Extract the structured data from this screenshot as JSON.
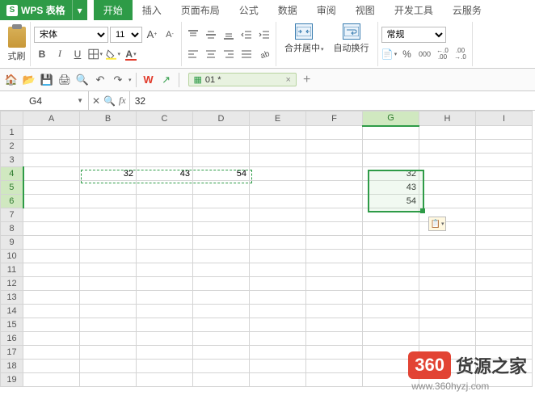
{
  "app": {
    "name": "WPS 表格",
    "logo_letter": "S"
  },
  "tabs": [
    "开始",
    "插入",
    "页面布局",
    "公式",
    "数据",
    "审阅",
    "视图",
    "开发工具",
    "云服务"
  ],
  "active_tab": 0,
  "ribbon": {
    "paste_label": "式刷",
    "font_name": "宋体",
    "font_size": "11",
    "merge_label": "合并居中",
    "wrap_label": "自动换行",
    "number_format": "常规",
    "bold": "B",
    "italic": "I",
    "underline": "U",
    "inc_font": "A",
    "dec_font": "A",
    "currency": "¥",
    "percent": "%",
    "comma": "000",
    "inc_dec_a": "←.0\n.00",
    "inc_dec_b": ".00\n→.0"
  },
  "qat": {
    "doc_name": "01 *"
  },
  "namebox": "G4",
  "fx_label": "fx",
  "formula_value": "32",
  "columns": [
    "A",
    "B",
    "C",
    "D",
    "E",
    "F",
    "G",
    "H",
    "I"
  ],
  "row_count": 19,
  "selected_col": "G",
  "selected_rows": [
    4,
    5,
    6
  ],
  "copy_range": {
    "r1": 4,
    "c1": "B",
    "r2": 4,
    "c2": "D"
  },
  "cells": {
    "B4": "32",
    "C4": "43",
    "D4": "54",
    "G4": "32",
    "G5": "43",
    "G6": "54"
  },
  "watermark": {
    "logo": "360",
    "brand": "货源之家",
    "url": "www.360hyzj.com"
  }
}
